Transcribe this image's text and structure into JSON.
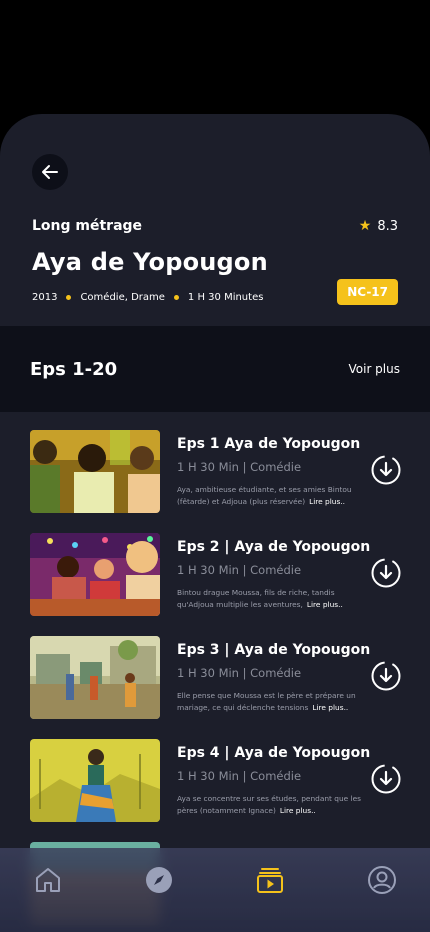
{
  "header": {
    "type_label": "Long métrage",
    "rating": "8.3",
    "title": "Aya de Yopougon",
    "year": "2013",
    "genres": "Comédie, Drame",
    "duration": "1 H 30 Minutes",
    "age_badge": "NC-17"
  },
  "episodes_section": {
    "title": "Eps 1-20",
    "more_label": "Voir plus"
  },
  "episodes": [
    {
      "title": "Eps 1 Aya de Yopougon",
      "sub": "1 H 30 Min | Comédie",
      "desc": "Aya, ambitieuse étudiante, et ses amies Bintou (fêtarde) et Adjoua (plus réservée)",
      "more": "Lire plus.."
    },
    {
      "title": "Eps 2 | Aya de Yopougon",
      "sub": "1 H 30 Min | Comédie",
      "desc": "Bintou drague Moussa, fils de riche, tandis qu'Adjoua multiplie les aventures,",
      "more": "Lire plus.."
    },
    {
      "title": "Eps 3 | Aya de Yopougon",
      "sub": "1 H 30 Min | Comédie",
      "desc": "Elle pense que Moussa est le père et prépare un mariage, ce qui déclenche tensions",
      "more": "Lire plus.."
    },
    {
      "title": "Eps 4 | Aya de Yopougon",
      "sub": "1 H 30 Min | Comédie",
      "desc": "Aya se concentre sur ses études, pendant que les pères (notamment Ignace)",
      "more": "Lire plus.."
    }
  ],
  "nav": {
    "items": [
      "home-icon",
      "compass-icon",
      "play-library-icon",
      "profile-icon"
    ],
    "active": "play-library-icon"
  },
  "colors": {
    "accent": "#f5c21b",
    "background": "#1c1e2a",
    "band": "#0e1019"
  }
}
